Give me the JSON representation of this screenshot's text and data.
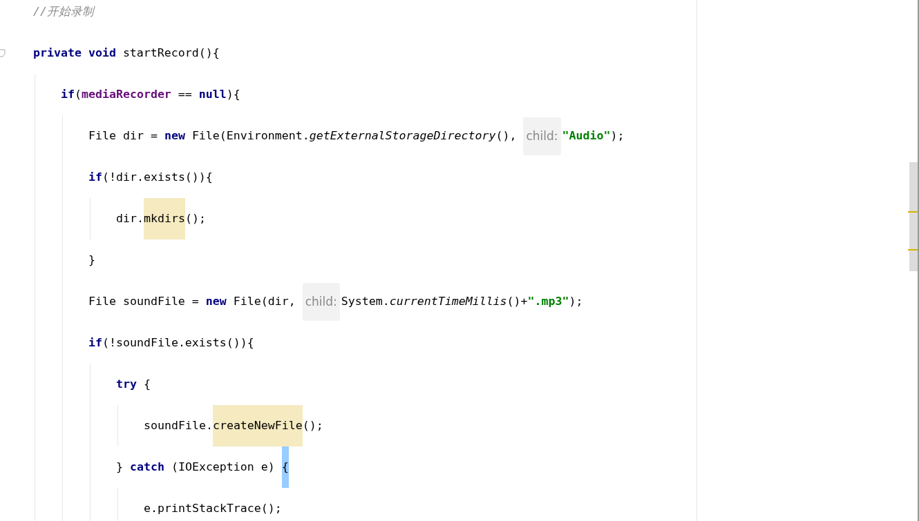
{
  "editor": {
    "lines": [
      {
        "foldable": false,
        "tokens": [
          {
            "kind": "comment",
            "text": "//开始录制"
          }
        ]
      },
      {
        "foldable": true,
        "tokens": [
          {
            "kind": "keyword",
            "text": "private void"
          },
          {
            "kind": "plain",
            "text": " startRecord(){"
          }
        ],
        "children": [
          {
            "foldable": false,
            "tokens": [
              {
                "kind": "keyword",
                "text": "if"
              },
              {
                "kind": "plain",
                "text": "("
              },
              {
                "kind": "field",
                "text": "mediaRecorder"
              },
              {
                "kind": "plain",
                "text": " == "
              },
              {
                "kind": "keyword",
                "text": "null"
              },
              {
                "kind": "plain",
                "text": "){"
              }
            ],
            "children": [
              {
                "foldable": false,
                "tokens": [
                  {
                    "kind": "plain",
                    "text": "File dir = "
                  },
                  {
                    "kind": "keyword",
                    "text": "new"
                  },
                  {
                    "kind": "plain",
                    "text": " File(Environment."
                  },
                  {
                    "kind": "static",
                    "text": "getExternalStorageDirectory"
                  },
                  {
                    "kind": "plain",
                    "text": "(), "
                  },
                  {
                    "kind": "hint",
                    "text": "child:"
                  },
                  {
                    "kind": "string",
                    "text": "\"Audio\""
                  },
                  {
                    "kind": "plain",
                    "text": ");"
                  }
                ]
              },
              {
                "foldable": false,
                "tokens": [
                  {
                    "kind": "keyword",
                    "text": "if"
                  },
                  {
                    "kind": "plain",
                    "text": "(!dir.exists()){"
                  }
                ],
                "children": [
                  {
                    "foldable": false,
                    "tokens": [
                      {
                        "kind": "plain",
                        "text": "dir."
                      },
                      {
                        "kind": "usage",
                        "text": "mkdirs"
                      },
                      {
                        "kind": "plain",
                        "text": "();"
                      }
                    ]
                  }
                ]
              },
              {
                "foldable": false,
                "tokens": [
                  {
                    "kind": "plain",
                    "text": "}"
                  }
                ]
              },
              {
                "foldable": false,
                "tokens": [
                  {
                    "kind": "plain",
                    "text": "File soundFile = "
                  },
                  {
                    "kind": "keyword",
                    "text": "new"
                  },
                  {
                    "kind": "plain",
                    "text": " File(dir, "
                  },
                  {
                    "kind": "hint",
                    "text": "child:"
                  },
                  {
                    "kind": "plain",
                    "text": "System."
                  },
                  {
                    "kind": "static",
                    "text": "currentTimeMillis"
                  },
                  {
                    "kind": "plain",
                    "text": "()+"
                  },
                  {
                    "kind": "string",
                    "text": "\".mp3\""
                  },
                  {
                    "kind": "plain",
                    "text": ");"
                  }
                ]
              },
              {
                "foldable": false,
                "tokens": [
                  {
                    "kind": "keyword",
                    "text": "if"
                  },
                  {
                    "kind": "plain",
                    "text": "(!soundFile.exists()){"
                  }
                ],
                "children": [
                  {
                    "foldable": false,
                    "tokens": [
                      {
                        "kind": "keyword",
                        "text": "try"
                      },
                      {
                        "kind": "plain",
                        "text": " {"
                      }
                    ],
                    "children": [
                      {
                        "foldable": false,
                        "tokens": [
                          {
                            "kind": "plain",
                            "text": "soundFile."
                          },
                          {
                            "kind": "usage",
                            "text": "createNewFile"
                          },
                          {
                            "kind": "plain",
                            "text": "();"
                          }
                        ]
                      }
                    ]
                  },
                  {
                    "foldable": false,
                    "tokens": [
                      {
                        "kind": "plain",
                        "text": "} "
                      },
                      {
                        "kind": "keyword",
                        "text": "catch"
                      },
                      {
                        "kind": "plain",
                        "text": " (IOException e) "
                      },
                      {
                        "kind": "brace",
                        "text": "{"
                      }
                    ],
                    "children": [
                      {
                        "foldable": false,
                        "tokens": [
                          {
                            "kind": "plain",
                            "text": "e.printStackTrace();"
                          }
                        ]
                      }
                    ]
                  }
                ]
              }
            ]
          }
        ]
      }
    ]
  }
}
